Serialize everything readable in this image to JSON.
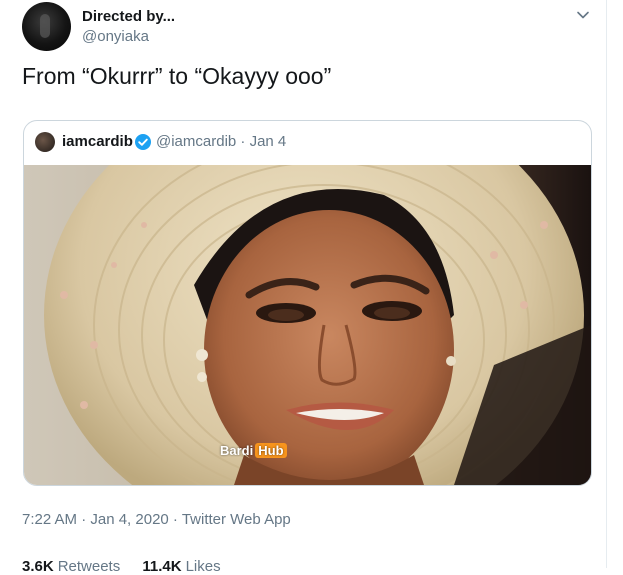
{
  "tweet": {
    "display_name": "Directed by...",
    "handle": "@onyiaka",
    "text": "From “Okurrr” to “Okayyy ooo”",
    "menu_icon": "chevron-down-icon"
  },
  "quote": {
    "name": "iamcardib",
    "verified_icon": "verified-badge-icon",
    "meta": "@iamcardib · Jan 4",
    "image_watermark": {
      "text": "Bardi",
      "badge": "Hub"
    }
  },
  "footer": {
    "time": "7:22 AM · Jan 4, 2020 · ",
    "source": "Twitter Web App"
  },
  "stats": {
    "retweets_count": "3.6K",
    "retweets_label": "Retweets",
    "likes_count": "11.4K",
    "likes_label": "Likes"
  },
  "colors": {
    "text": "#14171a",
    "secondary": "#657786",
    "border": "#ccd6dd",
    "verified": "#1da1f2"
  }
}
